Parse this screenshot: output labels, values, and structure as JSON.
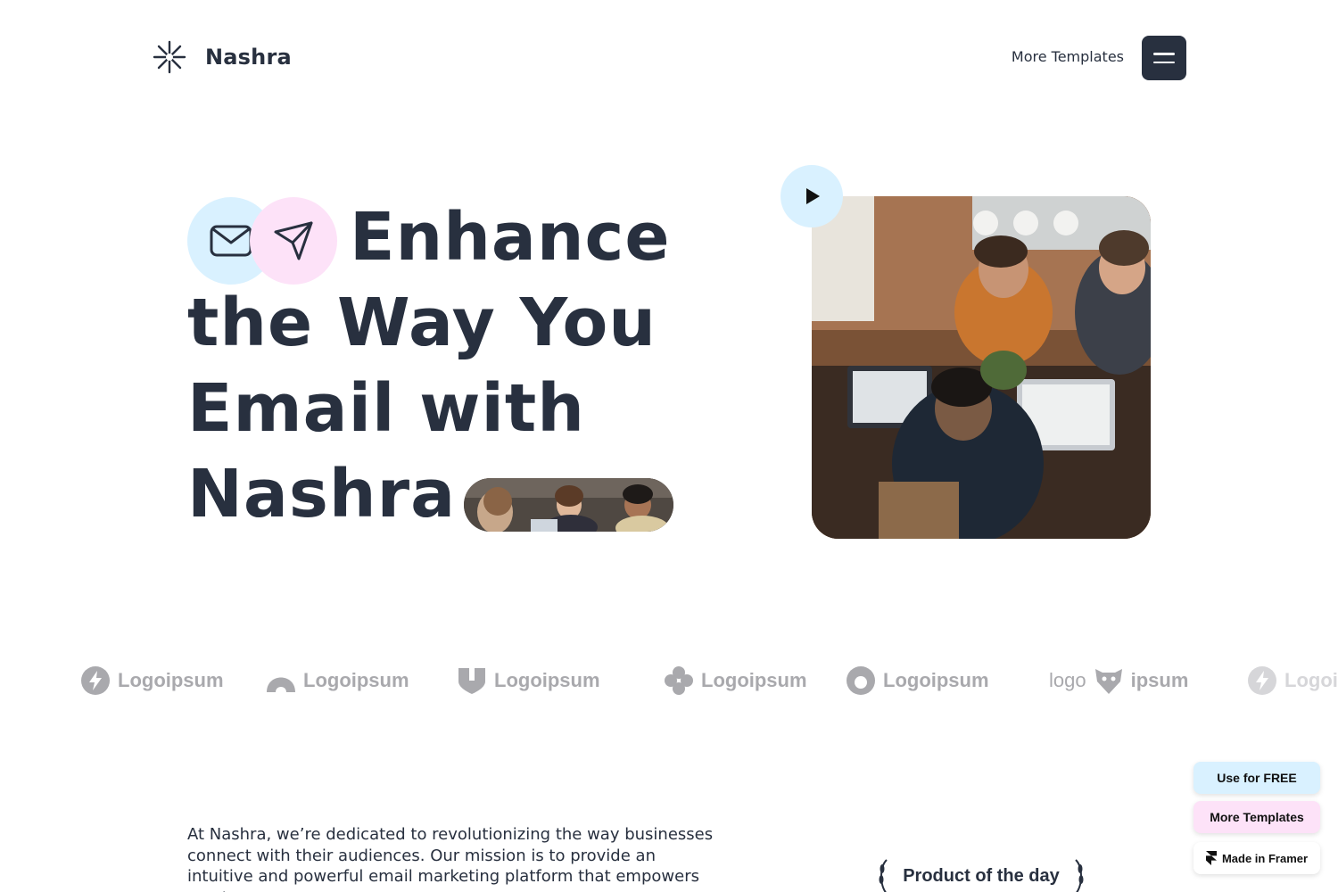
{
  "header": {
    "brand": "Nashra",
    "logo_icon": "asterisk-starburst-icon",
    "nav_link": "More Templates",
    "menu_icon": "hamburger-menu-icon"
  },
  "hero": {
    "title_lines": [
      "Enhance",
      "the Way You",
      "Email with",
      "Nashra"
    ],
    "icons": [
      "mail-envelope-icon",
      "send-paper-plane-icon"
    ],
    "play_icon": "play-icon"
  },
  "logos": [
    {
      "name": "Logoipsum",
      "icon": "bolt-circle-icon"
    },
    {
      "name": "Logoipsum",
      "icon": "arch-icon"
    },
    {
      "name": "Logoipsum",
      "icon": "shield-icon"
    },
    {
      "name": "Logoipsum",
      "icon": "flower-icon"
    },
    {
      "name": "Logoipsum",
      "icon": "ring-icon"
    },
    {
      "name": "logo ipsum",
      "icon": "bear-icon"
    },
    {
      "name": "Logoipsum",
      "icon": "bolt-circle-icon"
    }
  ],
  "about": {
    "text": "At Nashra, we’re dedicated to revolutionizing the way businesses connect with their audiences. Our mission is to provide an intuitive and powerful email marketing platform that empowers you to"
  },
  "product_of_the_day": "Product of the day",
  "floating": {
    "use_free": "Use for FREE",
    "more_templates": "More Templates",
    "made_in_framer": "Made in Framer"
  },
  "colors": {
    "text": "#28303f",
    "accent_blue": "#d9f1ff",
    "accent_pink": "#fde2f8",
    "logo_gray": "#a9a9ad"
  }
}
